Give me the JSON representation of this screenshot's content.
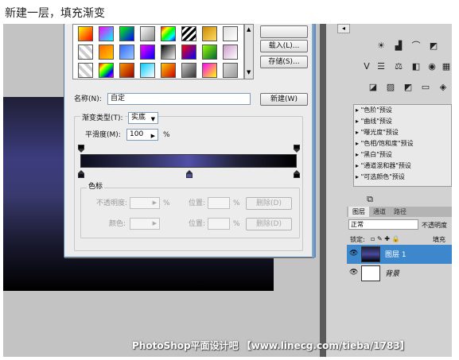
{
  "post": {
    "caption": "新建一层，填充渐变"
  },
  "dialog": {
    "load_button": "载入(L)...",
    "save_button": "存储(S)...",
    "name_label": "名称(N):",
    "name_value": "自定",
    "new_button": "新建(W)",
    "type_label": "渐变类型(T):",
    "type_value": "实底",
    "smooth_label": "平滑度(M):",
    "smooth_value": "100",
    "percent": "%",
    "stops_group": "色标",
    "opacity_label": "不透明度:",
    "opacity_unit": "%",
    "location_label": "位置:",
    "location_unit": "%",
    "delete_button": "删除(D)",
    "color_label": "颜色:"
  },
  "panel": {
    "presets": [
      "\"色阶\"预设",
      "\"曲线\"预设",
      "\"曝光度\"预设",
      "\"色相/饱和度\"预设",
      "\"黑白\"预设",
      "\"通道混和器\"预设",
      "\"可选颜色\"预设"
    ],
    "tabs": [
      "图层",
      "通道",
      "路径"
    ],
    "blend_mode": "正常",
    "opacity_label": "不透明度",
    "lock_label": "锁定:",
    "fill_label": "填充",
    "layers": [
      {
        "name": "图层 1"
      },
      {
        "name": "背景"
      }
    ]
  },
  "watermark": "PhotoShop平面设计吧 【www.linecg.com/tieba/1783】",
  "colors": {
    "selection": "#3d88cc",
    "gradient_mid": "#5050a8",
    "dialog_bg": "#ececec"
  }
}
